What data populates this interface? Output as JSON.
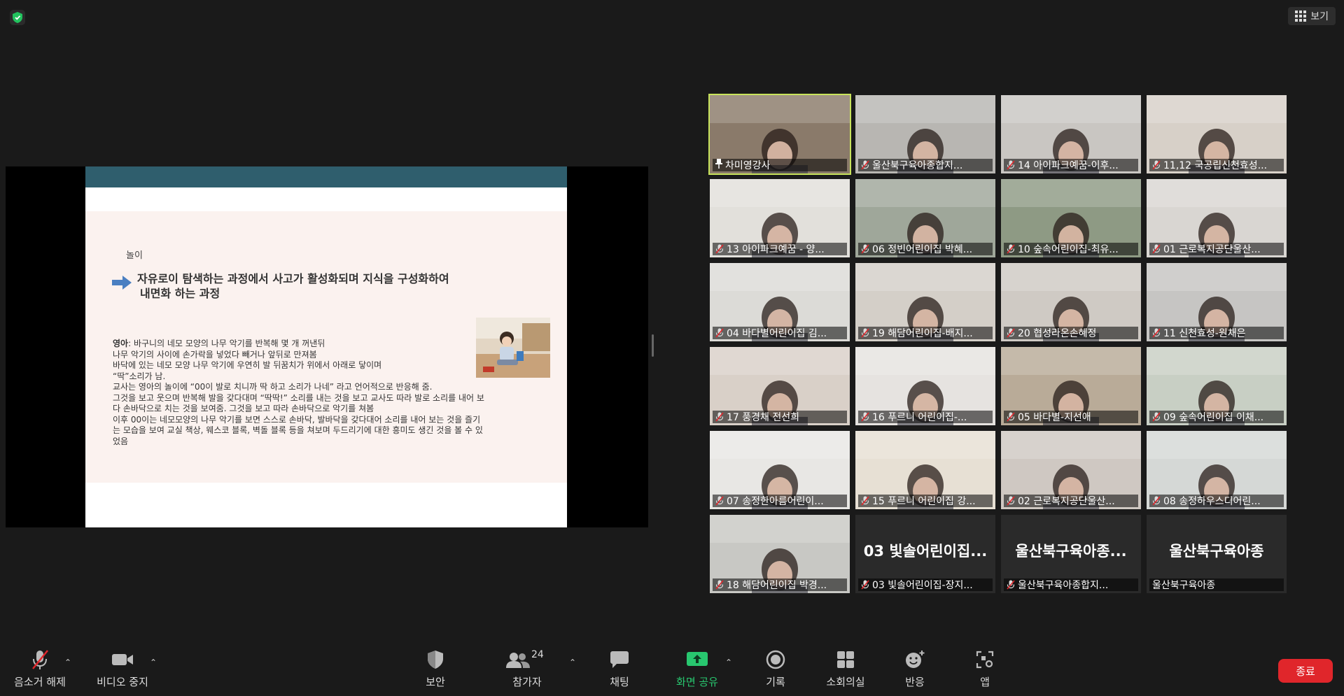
{
  "topbar": {
    "view_label": "보기"
  },
  "slide": {
    "tag": "놀이",
    "title_line1": "자유로이 탐색하는 과정에서 사고가 활성화되며 지식을 구성화하여",
    "title_line2": "내면화 하는 과정",
    "body_lead": "영아",
    "body_lines": [
      ": 바구니의 네모 모양의 나무 악기를 반복해 몇 개 꺼낸뒤",
      "나무 악기의 사이에 손가락을 넣었다 빼거나 앞뒤로 만져봄",
      "바닥에 있는 네모 모양 나무 악기에 우연히 발 뒤꿈치가 위에서 아래로 닿이며",
      "“딱”소리가 남.",
      "교사는 영아의 놀이에 “00이 발로 치니까 딱 하고 소리가 나네” 라고 언어적으로 반응해 줌.",
      "그것을 보고 웃으며 반복해 발을 갖다대며 “딱딱!” 소리를 내는 것을 보고 교사도 따라 발로 소리를 내어 보",
      "다 손바닥으로 치는 것을 보여줌. 그것을 보고 따라 손바닥으로 악기를 쳐봄",
      "이후 00이는 네모모양의 나무 악기를 보면 스스로 손바닥, 발바닥을 갖다대어 소리를 내어 보는 것을 즐기",
      "는 모습을 보여 교실 책상, 웨스코 블록, 벽돌 블록 등을 쳐보며 두드리기에 대한 흥미도 생긴 것을 볼 수 있",
      "었음"
    ]
  },
  "participants": [
    {
      "name": "차미영강사",
      "pinned": true,
      "muted": false,
      "video": true,
      "active": true,
      "bg": "#8a7a6a"
    },
    {
      "name": "울산북구육아종합지...",
      "muted": true,
      "video": true,
      "bg": "#b8b6b2"
    },
    {
      "name": "14 아이파크예꿈-이후...",
      "muted": true,
      "video": true,
      "bg": "#c9c6c2"
    },
    {
      "name": "11,12 국공립신천효성...",
      "muted": true,
      "video": true,
      "bg": "#d7d0c8"
    },
    {
      "name": "13 아이파크예꿈 - 양...",
      "muted": true,
      "video": true,
      "bg": "#e2e0db"
    },
    {
      "name": "06 정빈어린이집 박혜...",
      "muted": true,
      "video": true,
      "bg": "#9fa79a"
    },
    {
      "name": "10 숲속어린이집-최유...",
      "muted": true,
      "video": true,
      "bg": "#8e9a84"
    },
    {
      "name": "01 근로복지공단울산...",
      "muted": true,
      "video": true,
      "bg": "#d9d6d2"
    },
    {
      "name": "04 바다별어린이집 김...",
      "muted": true,
      "video": true,
      "bg": "#dcdbd7"
    },
    {
      "name": "19 해담어린이집-배지...",
      "muted": true,
      "video": true,
      "bg": "#d4cfc8"
    },
    {
      "name": "20 협성라온손혜정",
      "muted": true,
      "video": true,
      "bg": "#cfcac4"
    },
    {
      "name": "11 신천효성-원채은",
      "muted": true,
      "video": true,
      "bg": "#c6c5c3"
    },
    {
      "name": "17 풍경채 전선희",
      "muted": true,
      "video": true,
      "bg": "#d9d0c8"
    },
    {
      "name": "16 푸르니 어린이집-...",
      "muted": true,
      "video": true,
      "bg": "#e6e3e0"
    },
    {
      "name": "05 바다별-지선애",
      "muted": true,
      "video": true,
      "bg": "#b9ab98"
    },
    {
      "name": "09 숲속어린이집 이채...",
      "muted": true,
      "video": true,
      "bg": "#c8cfc4"
    },
    {
      "name": "07 송정한아름어린이...",
      "muted": true,
      "video": true,
      "bg": "#e8e7e4"
    },
    {
      "name": "15 푸르니 어린이집 강...",
      "muted": true,
      "video": true,
      "bg": "#e7e0d4"
    },
    {
      "name": "02 근로복지공단울산...",
      "muted": true,
      "video": true,
      "bg": "#cfc8c2"
    },
    {
      "name": "08 송정하우스디어린...",
      "muted": true,
      "video": true,
      "bg": "#d5d8d6"
    },
    {
      "name": "18 해담어린이집 박경...",
      "muted": true,
      "video": true,
      "bg": "#c8c8c4"
    },
    {
      "name": "03 빛솔어린이집-장지...",
      "muted": true,
      "video": false,
      "big": "03 빛솔어린이집...",
      "bg": "#2a2a2a"
    },
    {
      "name": "울산북구육아종합지...",
      "muted": true,
      "video": false,
      "big": "울산북구육아종...",
      "bg": "#2a2a2a"
    },
    {
      "name": "울산북구육아종",
      "muted": false,
      "video": false,
      "big": "울산북구육아종",
      "bg": "#2a2a2a"
    }
  ],
  "toolbar": {
    "unmute": "음소거 해제",
    "stop_video": "비디오 중지",
    "security": "보안",
    "participants": "참가자",
    "participant_count": "24",
    "chat": "채팅",
    "share_screen": "화면 공유",
    "record": "기록",
    "breakout": "소회의실",
    "reactions": "반응",
    "apps": "앱",
    "end": "종료"
  },
  "colors": {
    "accent_green": "#28c76f",
    "end_red": "#e0262b",
    "active_border": "#c8e35b",
    "slide_header": "#2f5e6d"
  }
}
